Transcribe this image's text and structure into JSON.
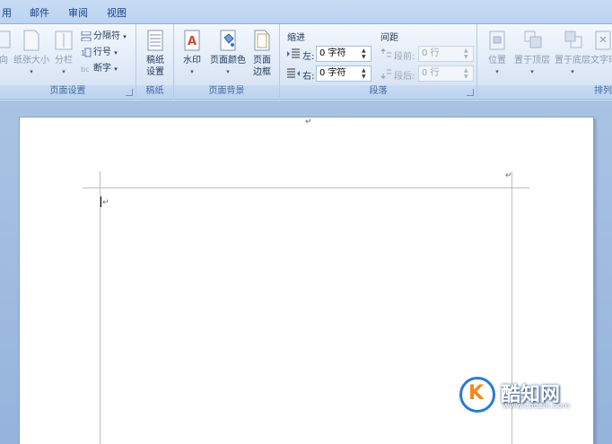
{
  "tabs": [
    {
      "label": "用"
    },
    {
      "label": "邮件"
    },
    {
      "label": "审阅"
    },
    {
      "label": "视图"
    }
  ],
  "ribbon": {
    "page_setup": {
      "label": "页面设置",
      "direction_label": "向",
      "paper_size_label": "纸张大小",
      "columns_label": "分栏",
      "breaks_label": "分隔符",
      "line_numbers_label": "行号",
      "hyphenation_label": "断字"
    },
    "manuscript": {
      "label": "稿纸",
      "settings_label_1": "稿纸",
      "settings_label_2": "设置"
    },
    "page_background": {
      "label": "页面背景",
      "watermark_label": "水印",
      "page_color_label": "页面颜色",
      "page_borders_label_1": "页面",
      "page_borders_label_2": "边框"
    },
    "paragraph": {
      "label": "段落",
      "indent_title": "缩进",
      "indent_left_label": "左:",
      "indent_left_value": "0 字符",
      "indent_right_label": "右:",
      "indent_right_value": "0 字符",
      "spacing_title": "间距",
      "spacing_before_label": "段前:",
      "spacing_before_value": "0 行",
      "spacing_after_label": "段后:",
      "spacing_after_value": "0 行"
    },
    "arrange": {
      "label": "排列",
      "position_label": "位置",
      "bring_front_label": "置于顶层",
      "send_back_label": "置于底层",
      "text_wrap_label": "文字环"
    }
  },
  "document": {
    "paragraph_mark": "↵"
  },
  "watermark": {
    "logo_letter": "K",
    "name": "酷知网",
    "url": "www.coozhi.com"
  },
  "colors": {
    "accent": "#2b7bd4",
    "logo_orange": "#f18a1c"
  }
}
